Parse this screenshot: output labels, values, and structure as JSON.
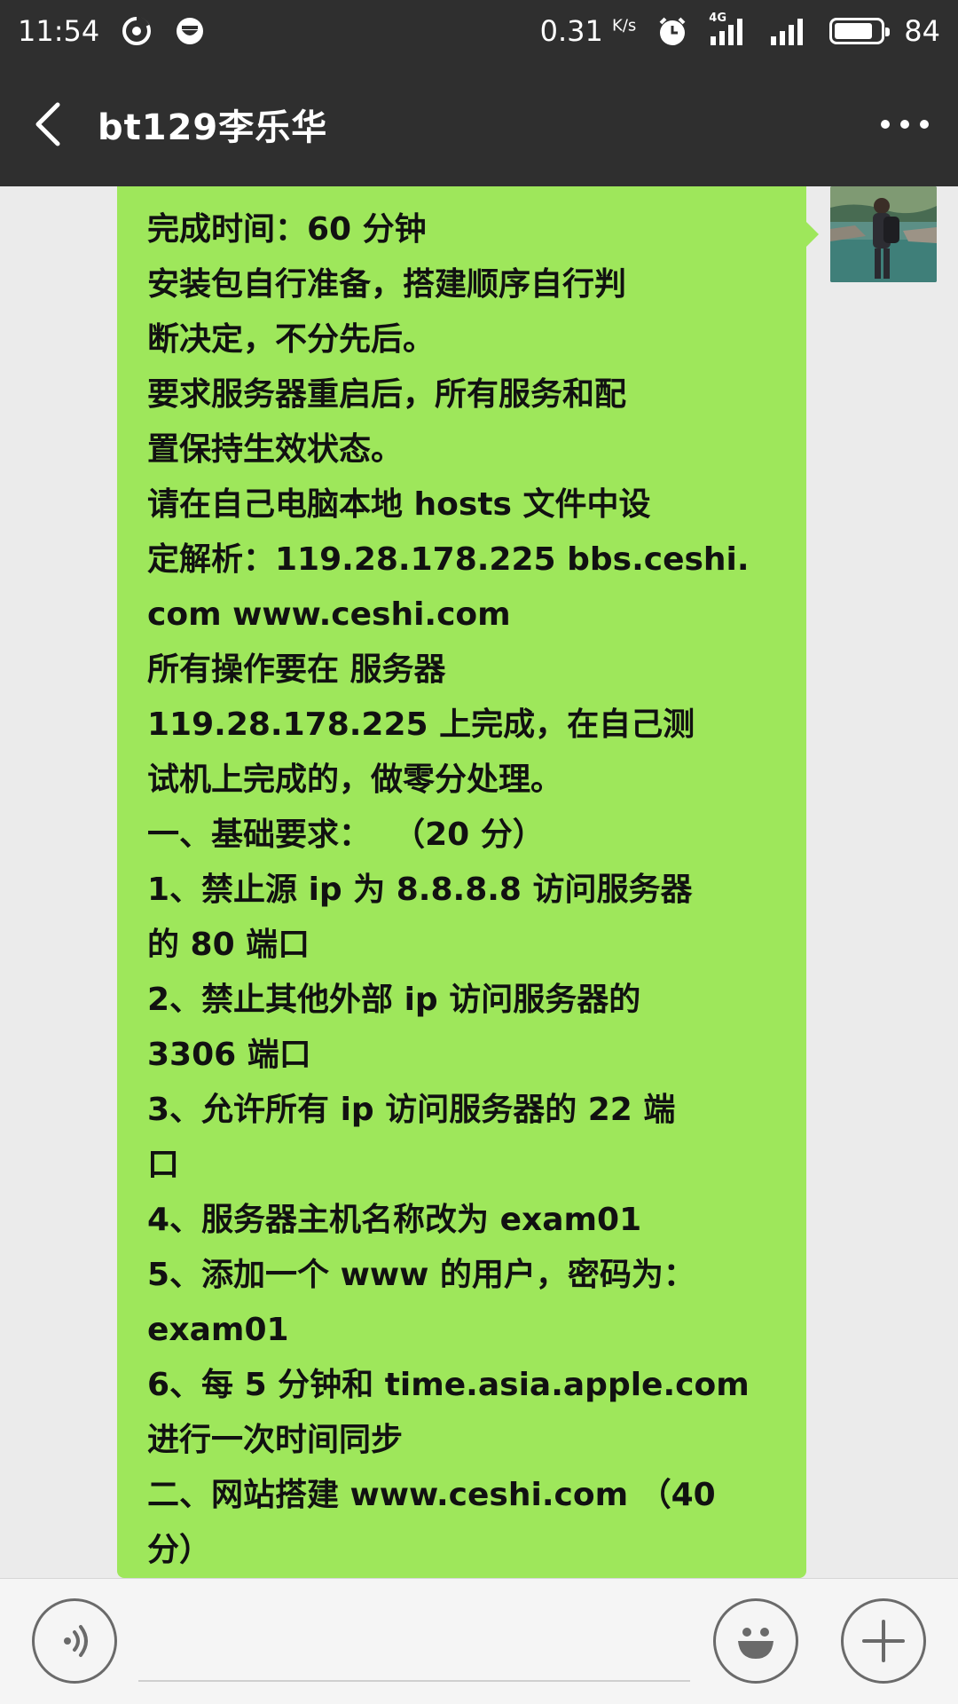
{
  "status_bar": {
    "time": "11:54",
    "speed": "0.31",
    "speed_unit": "K/s",
    "network_label": "4G",
    "battery": "84",
    "battery_level": 0.84
  },
  "header": {
    "title": "bt129李乐华",
    "back_icon": "chevron-left-icon",
    "more_icon": "more-dots-icon"
  },
  "message": {
    "lines": [
      "完成时间：60 分钟",
      "安装包自行准备，搭建顺序自行判",
      "断决定，不分先后。",
      "要求服务器重启后，所有服务和配",
      "置保持生效状态。",
      "请在自己电脑本地 hosts 文件中设",
      "定解析：119.28.178.225 bbs.ceshi.",
      "com www.ceshi.com",
      "所有操作要在 服务器",
      "119.28.178.225 上完成，在自己测",
      "试机上完成的，做零分处理。",
      "一、基础要求：  （20 分）",
      "1、禁止源 ip 为 8.8.8.8 访问服务器",
      "的 80 端口",
      "2、禁止其他外部 ip 访问服务器的",
      "3306 端口",
      "3、允许所有 ip 访问服务器的 22 端",
      "口",
      "4、服务器主机名称改为 exam01",
      "5、添加一个 www 的用户，密码为：",
      "exam01",
      "6、每 5 分钟和 time.asia.apple.com",
      "进行一次时间同步",
      "二、网站搭建 www.ceshi.com （40",
      "分）"
    ]
  },
  "input_bar": {
    "voice_icon": "voice-icon",
    "input_value": "",
    "emoji_icon": "emoji-icon",
    "plus_icon": "plus-icon"
  },
  "colors": {
    "header_bg": "#2f2f2f",
    "bubble_bg": "#9ee75b",
    "chat_bg": "#ebebeb"
  }
}
